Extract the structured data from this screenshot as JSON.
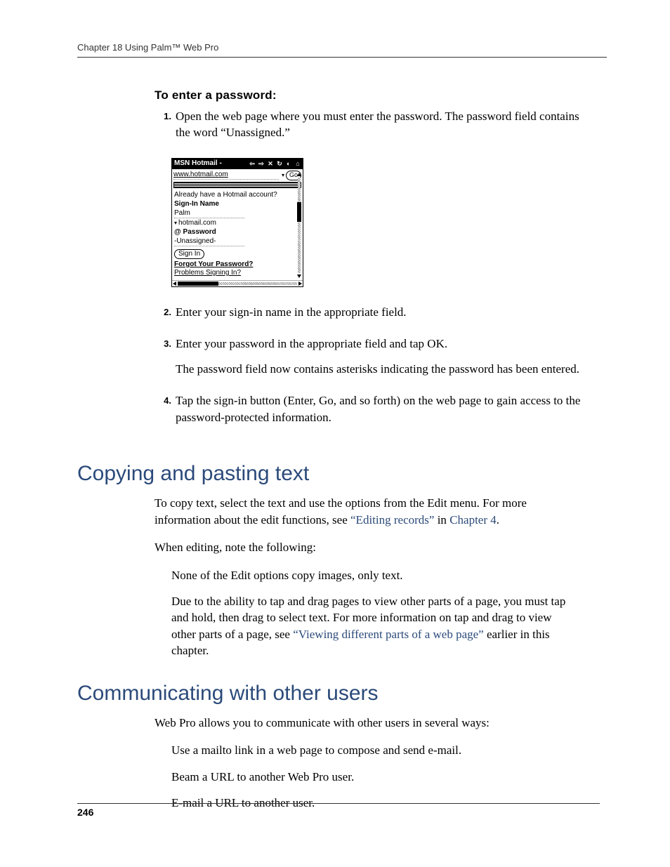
{
  "header": {
    "running": "Chapter 18   Using Palm™ Web Pro"
  },
  "procedure": {
    "title": "To enter a password:",
    "steps": [
      {
        "num": "1.",
        "text": "Open the web page where you must enter the password. The password field contains the word “Unassigned.”"
      },
      {
        "num": "2.",
        "text": "Enter your sign-in name in the appropriate field."
      },
      {
        "num": "3.",
        "text": "Enter your password in the appropriate field and tap OK.",
        "followup": "The password field now contains asterisks indicating the password has been entered."
      },
      {
        "num": "4.",
        "text": "Tap the sign-in button (Enter, Go, and so forth) on the web page to gain access to the password-protected information."
      }
    ]
  },
  "screenshot": {
    "title": "MSN Hotmail -",
    "url": "www.hotmail.com",
    "go_label": "Go",
    "prompt": "Already have a Hotmail account?",
    "signin_name_label": "Sign-In Name",
    "signin_name_value": "Palm",
    "domain": "hotmail.com",
    "password_label": "@ Password",
    "password_value": "-Unassigned-",
    "signin_button": "Sign In",
    "forgot_link": "Forgot Your Password?",
    "problems_link": "Problems Signing In?"
  },
  "sections": {
    "copy": {
      "title": "Copying and pasting text",
      "p1_before_link": "To copy text, select the text and use the options from the Edit menu. For more information about the edit functions, see ",
      "p1_link1": "“Editing records”",
      "p1_mid": " in ",
      "p1_link2": "Chapter 4",
      "p1_after": ".",
      "p2": "When editing, note the following:",
      "bullet1": "None of the Edit options copy images, only text.",
      "bullet2_before": "Due to the ability to tap and drag pages to view other parts of a page, you must tap and hold, then drag to select text. For more information on tap and drag to view other parts of a page, see ",
      "bullet2_link": "“Viewing different parts of a web page”",
      "bullet2_after": " earlier in this chapter."
    },
    "comm": {
      "title": "Communicating with other users",
      "intro": "Web Pro allows you to communicate with other users in several ways:",
      "b1": "Use a mailto link in a web page to compose and send e-mail.",
      "b2": "Beam a URL to another Web Pro user.",
      "b3": "E-mail a URL to another user."
    }
  },
  "page_number": "246"
}
